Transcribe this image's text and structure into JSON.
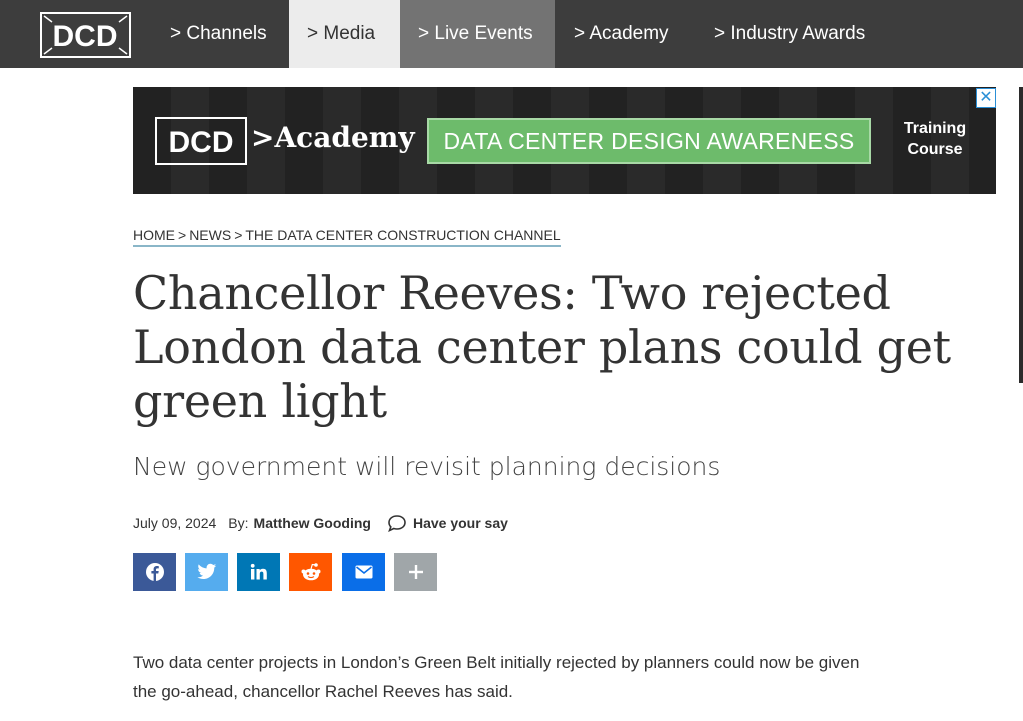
{
  "nav": {
    "logo_text": "DCD",
    "items": [
      {
        "label": "> Channels"
      },
      {
        "label": "> Media"
      },
      {
        "label": "> Live Events"
      },
      {
        "label": "> Academy"
      },
      {
        "label": "> Industry Awards"
      }
    ]
  },
  "ad": {
    "logo_text": "DCD",
    "brand": ">Academy",
    "cta": "DATA CENTER DESIGN AWARENESS",
    "course_line1": "Training",
    "course_line2": "Course",
    "close_glyph": "✕"
  },
  "breadcrumb": {
    "items": [
      "HOME",
      "NEWS",
      "THE DATA CENTER CONSTRUCTION CHANNEL"
    ],
    "separator": ">"
  },
  "article": {
    "title_line1": "Chancellor Reeves: Two rejected",
    "title_line2": "London data center plans could get",
    "title_line3": "green light",
    "subtitle": "New government will revisit planning decisions",
    "date": "July 09, 2024",
    "by_label": "By:",
    "author": "Matthew Gooding",
    "comment_label": "Have your say",
    "paragraph_line1": "Two data center projects in London’s Green Belt initially rejected by planners could now be given",
    "paragraph_line2": "the go-ahead, chancellor Rachel Reeves has said."
  },
  "share": [
    {
      "network": "facebook-icon",
      "color": "#3b5998"
    },
    {
      "network": "twitter-icon",
      "color": "#55acee"
    },
    {
      "network": "linkedin-icon",
      "color": "#0077b5"
    },
    {
      "network": "reddit-icon",
      "color": "#ff5700"
    },
    {
      "network": "email-icon",
      "color": "#0a6ee8"
    },
    {
      "network": "plus-icon",
      "color": "#a0a6a9"
    }
  ],
  "colors": {
    "nav_bg": "#3d3d3d",
    "nav_active_bg": "#ececec",
    "nav_live_bg": "#737373",
    "ad_cta": "#6dbb6b",
    "breadcrumb_underline": "#8ab6c8"
  }
}
